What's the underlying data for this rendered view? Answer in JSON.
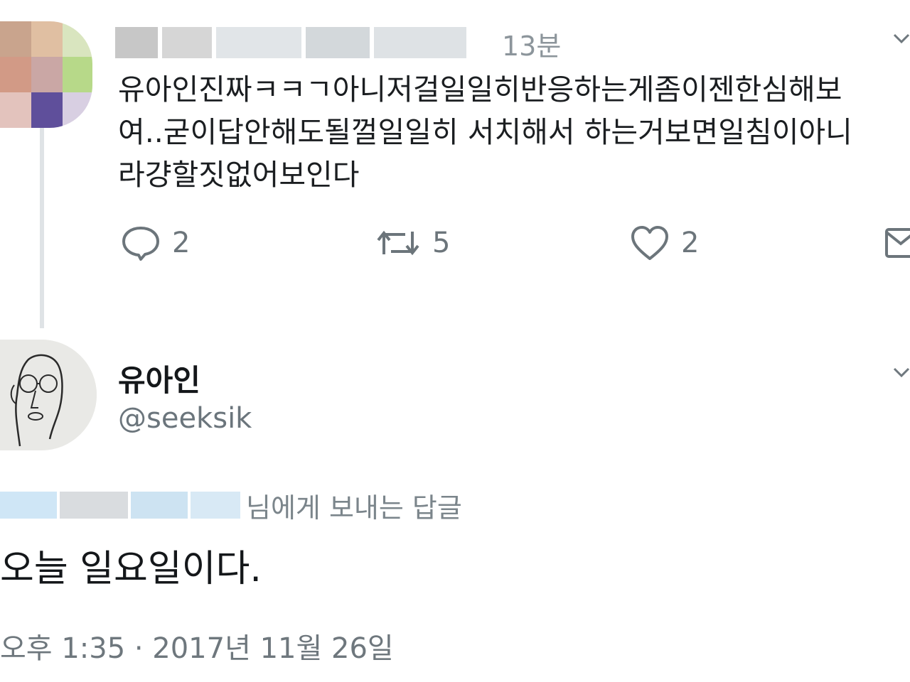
{
  "parent_tweet": {
    "time": "13분",
    "text_lines": [
      "유아인진짜ㅋㅋㄱ아니저걸일일히반응하는게좀이젠한심해보",
      "여..굳이답안해도될껄일일히 서치해서 하는거보면일침이아니",
      "라걍할짓없어보인다"
    ],
    "actions": {
      "reply_count": "2",
      "retweet_count": "5",
      "like_count": "2"
    }
  },
  "reply_tweet": {
    "display_name": "유아인",
    "handle": "@seeksik",
    "replying_to_suffix": "님에게 보내는 답글",
    "body": "오늘 일요일이다.",
    "timestamp": "오후 1:35 · 2017년 11월 26일"
  },
  "icons": {
    "reply": "speech-bubble-icon",
    "retweet": "retweet-icon",
    "like": "heart-icon",
    "dm": "envelope-icon",
    "menu": "chevron-down-icon"
  }
}
